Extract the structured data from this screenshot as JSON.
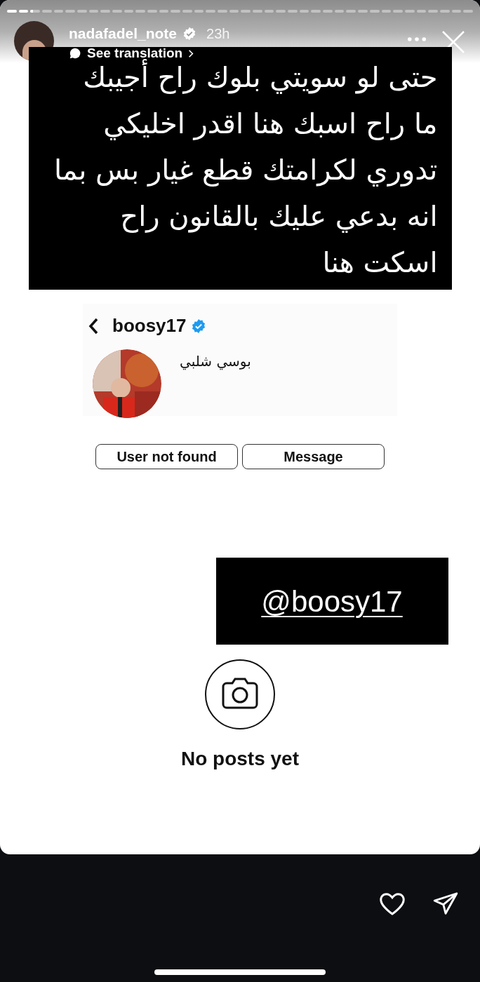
{
  "story_progress": [
    {
      "level": 1
    },
    {
      "level": 1
    },
    {
      "level": 0.3
    },
    {
      "level": 0
    },
    {
      "level": 0
    },
    {
      "level": 0
    },
    {
      "level": 0
    },
    {
      "level": 0
    },
    {
      "level": 0
    },
    {
      "level": 0
    },
    {
      "level": 0
    },
    {
      "level": 0
    },
    {
      "level": 0
    },
    {
      "level": 0
    },
    {
      "level": 0
    },
    {
      "level": 0
    },
    {
      "level": 0
    },
    {
      "level": 0
    },
    {
      "level": 0
    },
    {
      "level": 0
    },
    {
      "level": 0
    },
    {
      "level": 0
    },
    {
      "level": 0
    },
    {
      "level": 0
    },
    {
      "level": 0
    },
    {
      "level": 0
    },
    {
      "level": 0
    },
    {
      "level": 0
    },
    {
      "level": 0
    },
    {
      "level": 0
    },
    {
      "level": 0
    },
    {
      "level": 0
    },
    {
      "level": 0
    },
    {
      "level": 0
    },
    {
      "level": 0
    },
    {
      "level": 0
    },
    {
      "level": 0
    },
    {
      "level": 0
    },
    {
      "level": 0
    },
    {
      "level": 0
    }
  ],
  "header": {
    "username": "nadafadel_note",
    "verified": true,
    "time": "23h",
    "translation_link": "See translation"
  },
  "text_block": {
    "lines": [
      "حتى لو سويتي بلوك  راح أجيبك",
      "ما راح اسبك هنا اقدر اخليكي",
      "تدوري لكرامتك قطع غيار بس بما",
      "انه بدعي عليك بالقانون راح",
      "اسكت هنا"
    ]
  },
  "profile": {
    "username": "boosy17",
    "verified": true,
    "display_name": "بوسي شلبي",
    "status_button": "User not found",
    "message_button": "Message"
  },
  "mention_sticker": {
    "text": "@boosy17"
  },
  "empty_state": {
    "text": "No posts yet"
  }
}
